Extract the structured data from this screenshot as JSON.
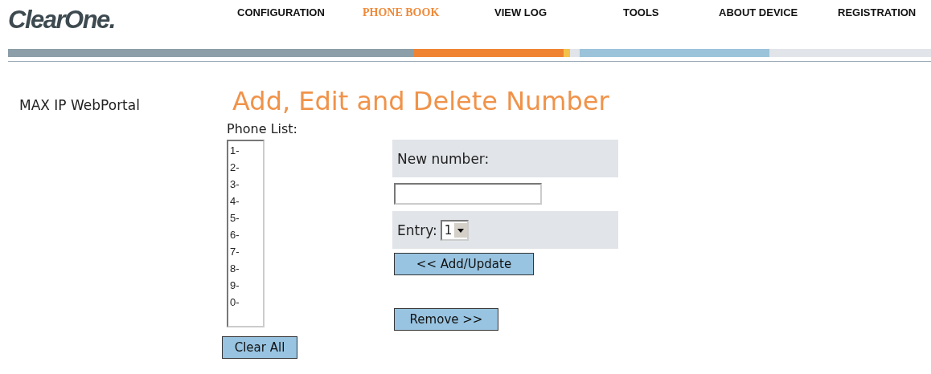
{
  "logo": "ClearOne.",
  "nav": [
    {
      "label": "CONFIGURATION",
      "selected": false
    },
    {
      "label": "PHONE BOOK",
      "selected": true
    },
    {
      "label": "VIEW LOG",
      "selected": false
    },
    {
      "label": "TOOLS",
      "selected": false
    },
    {
      "label": "ABOUT DEVICE",
      "selected": false
    },
    {
      "label": "REGISTRATION",
      "selected": false
    }
  ],
  "sidebar": {
    "title": "MAX IP WebPortal"
  },
  "page_title": "Add, Edit and Delete Number",
  "phone_list": {
    "label": "Phone List:",
    "items": [
      "1-",
      "2-",
      "3-",
      "4-",
      "5-",
      "6-",
      "7-",
      "8-",
      "9-",
      "0-"
    ]
  },
  "clear_button": "Clear All",
  "new_number": {
    "label": "New number:"
  },
  "entry": {
    "label": "Entry:",
    "value": "1"
  },
  "add_button": "<< Add/Update",
  "remove_button": "Remove >>"
}
